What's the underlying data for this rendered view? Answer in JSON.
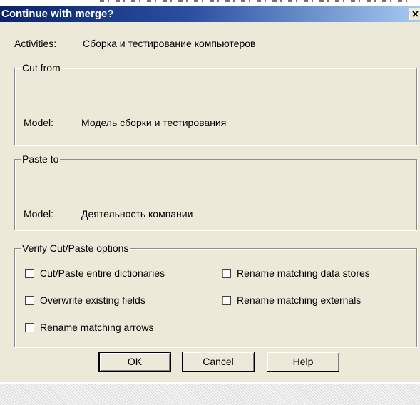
{
  "window": {
    "title": "Continue with merge?",
    "close_icon": "close-icon"
  },
  "activities": {
    "label": "Activities:",
    "value": "Сборка и тестирование  компьютеров"
  },
  "cut_from": {
    "legend": "Cut from",
    "model_label": "Model:",
    "model_value": "Модель сборки и тестирования"
  },
  "paste_to": {
    "legend": "Paste to",
    "model_label": "Model:",
    "model_value": "Деятельность компании"
  },
  "options": {
    "legend": "Verify Cut/Paste options",
    "items": [
      {
        "label": "Cut/Paste entire dictionaries",
        "checked": false
      },
      {
        "label": "Rename matching data stores",
        "checked": false
      },
      {
        "label": "Overwrite existing fields",
        "checked": false
      },
      {
        "label": "Rename matching externals",
        "checked": false
      },
      {
        "label": "Rename matching arrows",
        "checked": false
      }
    ]
  },
  "buttons": {
    "ok": "OK",
    "cancel": "Cancel",
    "help": "Help"
  }
}
